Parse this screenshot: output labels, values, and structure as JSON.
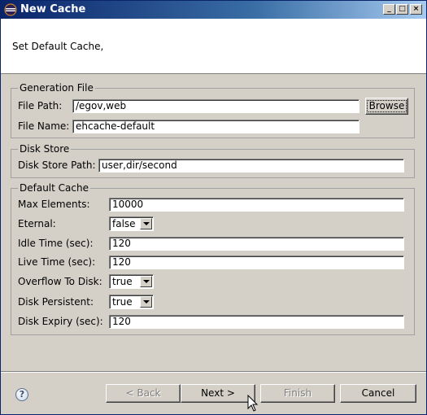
{
  "window": {
    "title": "New Cache",
    "controls": {
      "minimize": "_",
      "maximize": "□",
      "close": "×"
    }
  },
  "header": {
    "message": "Set Default Cache,"
  },
  "generation_file": {
    "legend": "Generation File",
    "file_path_label": "File Path:",
    "file_path_value": "/egov,web",
    "browse_label": "Browse",
    "file_name_label": "File Name:",
    "file_name_value": "ehcache-default"
  },
  "disk_store": {
    "legend": "Disk Store",
    "path_label": "Disk Store Path:",
    "path_value": "user,dir/second"
  },
  "default_cache": {
    "legend": "Default Cache",
    "max_elements_label": "Max Elements:",
    "max_elements_value": "10000",
    "eternal_label": "Eternal:",
    "eternal_value": "false",
    "idle_time_label": "Idle Time (sec):",
    "idle_time_value": "120",
    "live_time_label": "Live Time (sec):",
    "live_time_value": "120",
    "overflow_label": "Overflow To Disk:",
    "overflow_value": "true",
    "disk_persistent_label": "Disk Persistent:",
    "disk_persistent_value": "true",
    "disk_expiry_label": "Disk Expiry (sec):",
    "disk_expiry_value": "120"
  },
  "footer": {
    "help_glyph": "?",
    "back_label": "< Back",
    "next_label": "Next >",
    "finish_label": "Finish",
    "cancel_label": "Cancel"
  }
}
